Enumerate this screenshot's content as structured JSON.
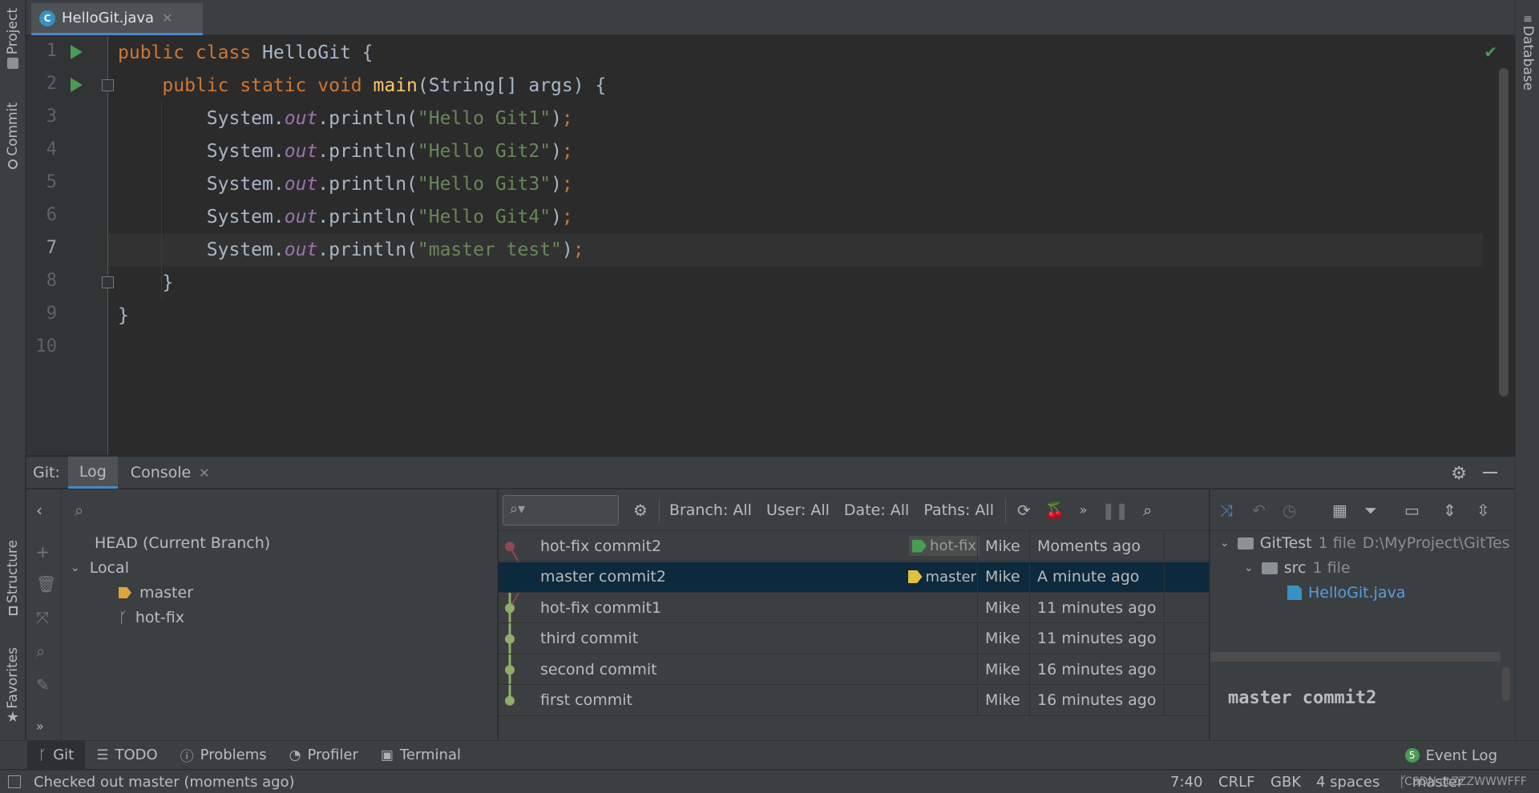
{
  "left_strip": {
    "project": "Project",
    "commit": "Commit",
    "structure": "Structure",
    "favorites": "Favorites"
  },
  "right_strip": {
    "database": "Database"
  },
  "editor_tab": {
    "file_name": "HelloGit.java",
    "icon_letter": "C"
  },
  "editor": {
    "lines": [
      {
        "n": "1",
        "tokens": [
          {
            "t": "public class ",
            "c": "kw"
          },
          {
            "t": "HelloGit ",
            "c": "cls"
          },
          {
            "t": "{",
            "c": "cls"
          }
        ]
      },
      {
        "n": "2",
        "tokens": [
          {
            "t": "    public static void ",
            "c": "kw"
          },
          {
            "t": "main",
            "c": "fn"
          },
          {
            "t": "(String[] args) {",
            "c": "cls"
          }
        ]
      },
      {
        "n": "3",
        "tokens": [
          {
            "t": "        System.",
            "c": "cls"
          },
          {
            "t": "out",
            "c": "fld"
          },
          {
            "t": ".println(",
            "c": "cls"
          },
          {
            "t": "\"Hello Git1\"",
            "c": "str"
          },
          {
            "t": ")",
            "c": "cls"
          },
          {
            "t": ";",
            "c": "kw"
          }
        ]
      },
      {
        "n": "4",
        "tokens": [
          {
            "t": "        System.",
            "c": "cls"
          },
          {
            "t": "out",
            "c": "fld"
          },
          {
            "t": ".println(",
            "c": "cls"
          },
          {
            "t": "\"Hello Git2\"",
            "c": "str"
          },
          {
            "t": ")",
            "c": "cls"
          },
          {
            "t": ";",
            "c": "kw"
          }
        ]
      },
      {
        "n": "5",
        "tokens": [
          {
            "t": "        System.",
            "c": "cls"
          },
          {
            "t": "out",
            "c": "fld"
          },
          {
            "t": ".println(",
            "c": "cls"
          },
          {
            "t": "\"Hello Git3\"",
            "c": "str"
          },
          {
            "t": ")",
            "c": "cls"
          },
          {
            "t": ";",
            "c": "kw"
          }
        ]
      },
      {
        "n": "6",
        "tokens": [
          {
            "t": "        System.",
            "c": "cls"
          },
          {
            "t": "out",
            "c": "fld"
          },
          {
            "t": ".println(",
            "c": "cls"
          },
          {
            "t": "\"Hello Git4\"",
            "c": "str"
          },
          {
            "t": ")",
            "c": "cls"
          },
          {
            "t": ";",
            "c": "kw"
          }
        ]
      },
      {
        "n": "7",
        "tokens": [
          {
            "t": "        System.",
            "c": "cls"
          },
          {
            "t": "out",
            "c": "fld"
          },
          {
            "t": ".println(",
            "c": "cls"
          },
          {
            "t": "\"master test\"",
            "c": "str"
          },
          {
            "t": ")",
            "c": "cls"
          },
          {
            "t": ";",
            "c": "kw"
          }
        ]
      },
      {
        "n": "8",
        "tokens": [
          {
            "t": "    }",
            "c": "cls"
          }
        ]
      },
      {
        "n": "9",
        "tokens": [
          {
            "t": "}",
            "c": "cls"
          }
        ]
      },
      {
        "n": "10",
        "tokens": []
      }
    ],
    "current_line": "7"
  },
  "git_panel": {
    "label": "Git:",
    "tabs": {
      "log": "Log",
      "console": "Console"
    }
  },
  "branches": {
    "head": "HEAD (Current Branch)",
    "local": "Local",
    "master": "master",
    "hotfix": "hot-fix"
  },
  "log_toolbar": {
    "branch": "Branch: All",
    "user": "User: All",
    "date": "Date: All",
    "paths": "Paths: All",
    "more": "»"
  },
  "commits": [
    {
      "message": "hot-fix commit2",
      "ref": "hot-fix",
      "author": "Mike",
      "date": "Moments ago"
    },
    {
      "message": "master commit2",
      "ref": "master",
      "author": "Mike",
      "date": "A minute ago"
    },
    {
      "message": "hot-fix commit1",
      "ref": "",
      "author": "Mike",
      "date": "11 minutes ago"
    },
    {
      "message": "third commit",
      "ref": "",
      "author": "Mike",
      "date": "11 minutes ago"
    },
    {
      "message": "second commit",
      "ref": "",
      "author": "Mike",
      "date": "16 minutes ago"
    },
    {
      "message": "first commit",
      "ref": "",
      "author": "Mike",
      "date": "16 minutes ago"
    }
  ],
  "selected_commit_index": 1,
  "colors": {
    "master_node": "#8fae6a",
    "hotfix_node": "#8b4a55",
    "selection": "#0d293e",
    "accent": "#4a88c7"
  },
  "details": {
    "root": "GitTest",
    "root_count": "1 file",
    "root_path": "D:\\MyProject\\GitTes",
    "src": "src",
    "src_count": "1 file",
    "file": "HelloGit.java",
    "commit_message": "master commit2"
  },
  "toolwindows": {
    "git": "Git",
    "todo": "TODO",
    "problems": "Problems",
    "profiler": "Profiler",
    "terminal": "Terminal",
    "event_log": "Event Log",
    "event_count": "5"
  },
  "status_bar": {
    "message": "Checked out master (moments ago)",
    "position": "7:40",
    "line_sep": "CRLF",
    "encoding": "GBK",
    "indent": "4 spaces",
    "branch": "master",
    "watermark": "CSDN @ZZZWWWFFF"
  }
}
